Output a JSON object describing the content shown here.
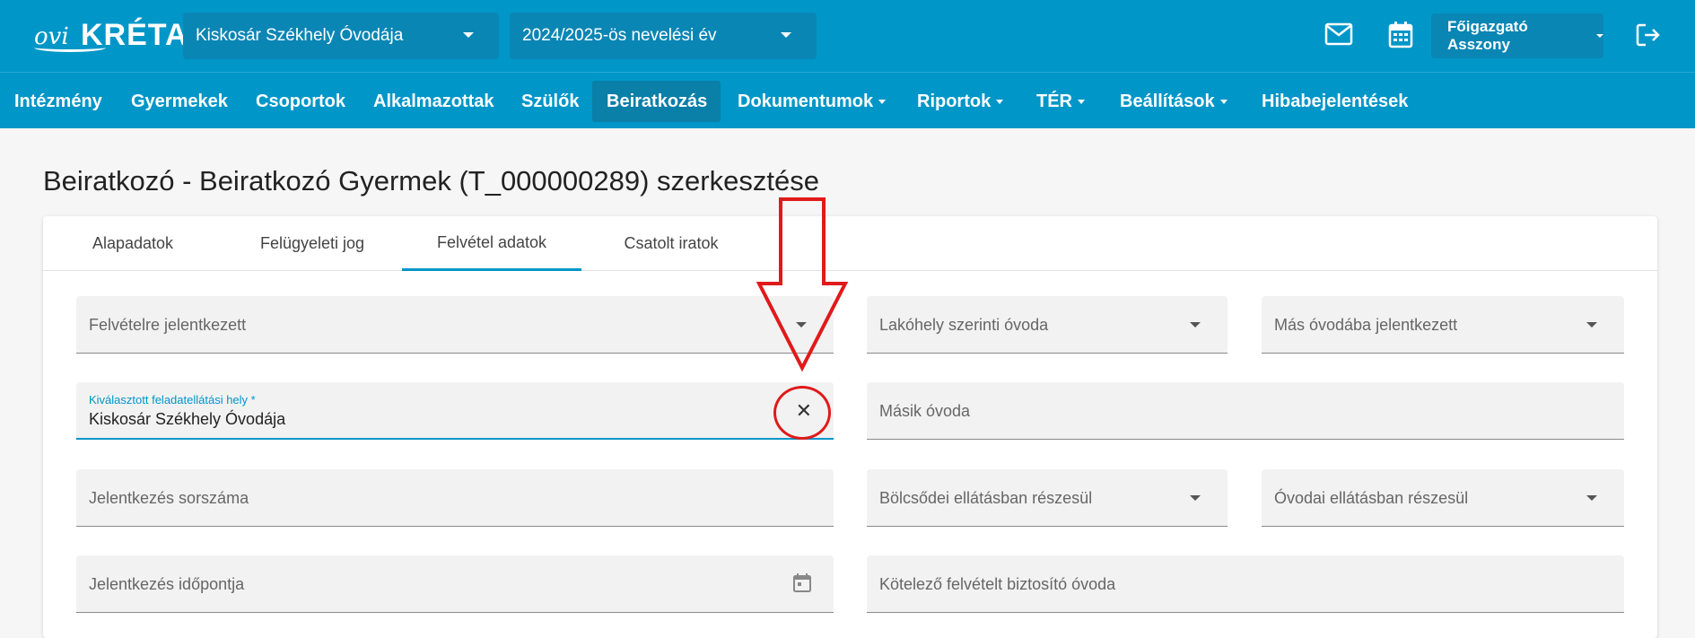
{
  "header": {
    "logo_prefix": "ovi",
    "logo_text": "KRÉTA",
    "institution": "Kiskosár Székhely Óvodája",
    "year": "2024/2025-ös nevelési év",
    "user": "Főigazgató Asszony"
  },
  "nav": {
    "items": [
      {
        "label": "Intézmény"
      },
      {
        "label": "Gyermekek"
      },
      {
        "label": "Csoportok"
      },
      {
        "label": "Alkalmazottak"
      },
      {
        "label": "Szülők"
      },
      {
        "label": "Beiratkozás"
      },
      {
        "label": "Dokumentumok"
      },
      {
        "label": "Riportok"
      },
      {
        "label": "TÉR"
      },
      {
        "label": "Beállítások"
      },
      {
        "label": "Hibabejelentések"
      }
    ],
    "active": "Beiratkozás"
  },
  "page": {
    "title": "Beiratkozó - Beiratkozó Gyermek (T_000000289) szerkesztése"
  },
  "tabs": [
    {
      "label": "Alapadatok"
    },
    {
      "label": "Felügyeleti jog"
    },
    {
      "label": "Felvétel adatok"
    },
    {
      "label": "Csatolt iratok"
    }
  ],
  "active_tab": "Felvétel adatok",
  "form": {
    "felvetelre_jelentkezett": "Felvételre jelentkezett",
    "lakohely_ovoda": "Lakóhely szerinti óvoda",
    "mas_ovodaba": "Más óvodába jelentkezett",
    "feladatellatasi_hely_label": "Kiválasztott feladatellátási hely *",
    "feladatellatasi_hely_value": "Kiskosár Székhely Óvodája",
    "masik_ovoda": "Másik óvoda",
    "jelentkezes_sorszama": "Jelentkezés sorszáma",
    "bolcsodei_ellatas": "Bölcsődei ellátásban részesül",
    "ovodai_ellatas": "Óvodai ellátásban részesül",
    "jelentkezes_idopontja": "Jelentkezés időpontja",
    "kotelezo_ovoda": "Kötelező felvételt biztosító óvoda"
  },
  "colors": {
    "brand": "#0096c8",
    "annotation": "#e01a1a"
  }
}
